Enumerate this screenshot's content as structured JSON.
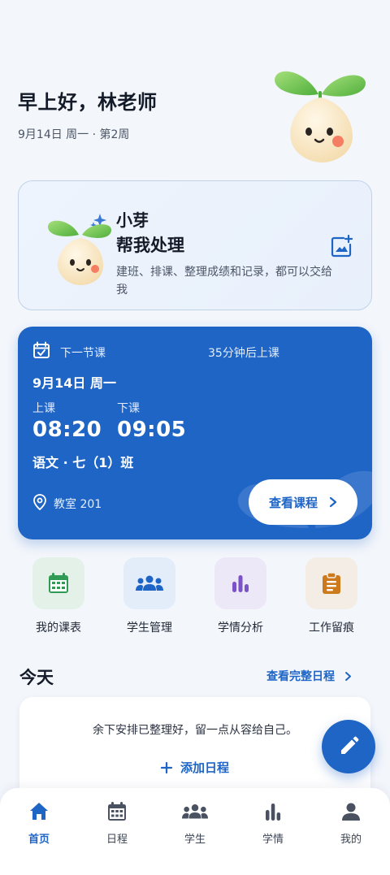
{
  "header": {
    "greeting": "早上好，林老师",
    "date_line": "9月14日 周一 · 第2周"
  },
  "assistant": {
    "name": "小芽",
    "title": "帮我处理",
    "description": "建班、排课、整理成绩和记录，都可以交给我"
  },
  "next_class": {
    "label": "下一节课",
    "countdown": "35分钟后上课",
    "date": "9月14日  周一",
    "start_label": "上课",
    "start_time": "08:20",
    "end_label": "下课",
    "end_time": "09:05",
    "class_name": "语文 · 七（1）班",
    "room": "教室 201",
    "view_button": "查看课程"
  },
  "quick_actions": [
    {
      "label": "我的课表",
      "icon": "calendar-grid-icon",
      "tile_color": "#e4f1e9",
      "icon_color": "#2f9b55"
    },
    {
      "label": "学生管理",
      "icon": "group-icon",
      "tile_color": "#e3edfa",
      "icon_color": "#1f65c6"
    },
    {
      "label": "学情分析",
      "icon": "bar-chart-icon",
      "tile_color": "#ece8f8",
      "icon_color": "#7b52c8"
    },
    {
      "label": "工作留痕",
      "icon": "clipboard-icon",
      "tile_color": "#f4ede5",
      "icon_color": "#cc7a1c"
    }
  ],
  "today": {
    "title": "今天",
    "full_schedule_link": "查看完整日程",
    "message": "余下安排已整理好，留一点从容给自己。",
    "add_label": "添加日程"
  },
  "bottom_nav": [
    {
      "label": "首页",
      "icon": "home-icon",
      "active": true
    },
    {
      "label": "日程",
      "icon": "calendar-icon",
      "active": false
    },
    {
      "label": "学生",
      "icon": "group-icon",
      "active": false
    },
    {
      "label": "学情",
      "icon": "bar-chart-icon",
      "active": false
    },
    {
      "label": "我的",
      "icon": "person-icon",
      "active": false
    }
  ],
  "colors": {
    "primary": "#1f65c6",
    "background": "#f3f6fb"
  }
}
